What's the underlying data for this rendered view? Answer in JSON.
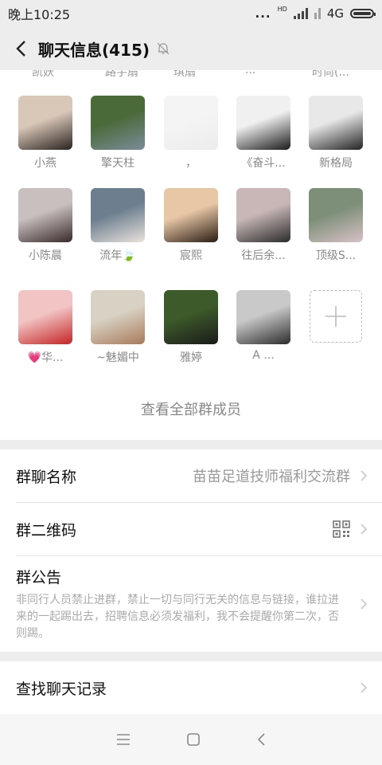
{
  "status_bar": {
    "time": "晚上10:25",
    "dots": "...",
    "hd": "HD",
    "network": "4G"
  },
  "header": {
    "title": "聊天信息(415)"
  },
  "members_partial": [
    "凯妖",
    "路芋扇",
    "琪扇",
    "...",
    "时尚(..."
  ],
  "members": [
    {
      "name": "小燕",
      "colors": [
        "#d9c7b8",
        "#2a2320"
      ]
    },
    {
      "name": "擎天柱",
      "colors": [
        "#4b6a3a",
        "#7a8c9a"
      ]
    },
    {
      "name": "，",
      "colors": [
        "#f4f4f4",
        "#ececec"
      ]
    },
    {
      "name": "《奋斗...",
      "colors": [
        "#f0f0f0",
        "#1a1a1a"
      ]
    },
    {
      "name": "新格局",
      "colors": [
        "#e8e8e8",
        "#222222"
      ]
    },
    {
      "name": "小陈晨",
      "colors": [
        "#c8bfbf",
        "#3a2a2a"
      ]
    },
    {
      "name": "流年🍃",
      "colors": [
        "#6d7f8f",
        "#e9e2dc"
      ]
    },
    {
      "name": "宸熙",
      "colors": [
        "#e7c7a6",
        "#2b1c14"
      ]
    },
    {
      "name": "往后余...",
      "colors": [
        "#c9b7b7",
        "#2b2b2b"
      ]
    },
    {
      "name": "顶级S...",
      "colors": [
        "#7d8f78",
        "#d8c0c8"
      ]
    },
    {
      "name": "💗华...",
      "colors": [
        "#f2c4c4",
        "#c42424"
      ]
    },
    {
      "name": "~魅媚中",
      "colors": [
        "#d8d2c4",
        "#a87a5a"
      ]
    },
    {
      "name": "雅婷",
      "colors": [
        "#3d5a2a",
        "#1a1a1a"
      ]
    },
    {
      "name": "A ...",
      "colors": [
        "#c9c9c9",
        "#2c2c2c"
      ]
    }
  ],
  "view_all_label": "查看全部群成员",
  "group_name": {
    "label": "群聊名称",
    "value": "苗苗足道技师福利交流群"
  },
  "qr_code": {
    "label": "群二维码"
  },
  "notice": {
    "label": "群公告",
    "text": "非同行人员禁止进群，禁止一切与同行无关的信息与链接，谁拉进来的一起踢出去，招聘信息必须发福利，我不会提醒你第二次，否则踢。"
  },
  "search_history": {
    "label": "查找聊天记录"
  }
}
